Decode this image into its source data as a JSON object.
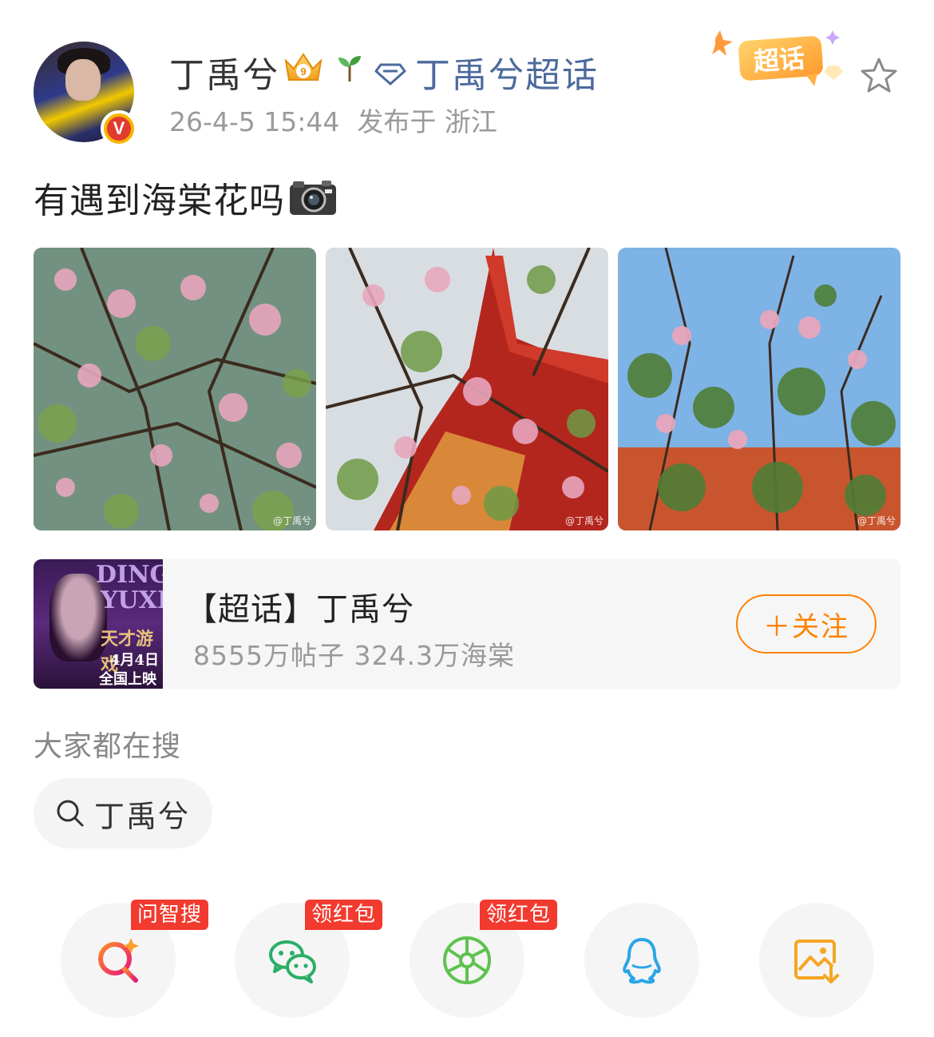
{
  "header": {
    "username": "丁禹兮",
    "supertopic_link": "丁禹兮超话",
    "timestamp": "26-4-5 15:44",
    "location": "发布于 浙江",
    "supertopic_badge": "超话",
    "icons": [
      "avatar",
      "verified-v-icon",
      "crown-level-icon",
      "sprout-icon",
      "diamond-icon",
      "supertopic-badge-icon",
      "star-icon"
    ],
    "level": "9"
  },
  "post": {
    "text": "有遇到海棠花吗",
    "emoji": "camera-icon",
    "images": [
      {
        "name": "photo-1",
        "watermark": "@丁禹兮"
      },
      {
        "name": "photo-2",
        "watermark": "@丁禹兮"
      },
      {
        "name": "photo-3",
        "watermark": "@丁禹兮"
      }
    ]
  },
  "topic_card": {
    "title": "【超话】丁禹兮",
    "stats": "8555万帖子 324.3万海棠",
    "follow_label": "＋关注",
    "poster": {
      "line1": "DING",
      "line2": "YUXI",
      "line3": "天才游戏",
      "line4": "4月4日",
      "line5": "全国上映"
    }
  },
  "search": {
    "heading": "大家都在搜",
    "chip": "丁禹兮"
  },
  "share": {
    "items": [
      {
        "name": "wenzhisou",
        "icon": "search-sparkle-icon",
        "tag": "问智搜",
        "accent": "#f0325a"
      },
      {
        "name": "wechat",
        "icon": "wechat-icon",
        "tag": "领红包",
        "accent": "#2aae67"
      },
      {
        "name": "moments",
        "icon": "moments-shutter-icon",
        "tag": "领红包",
        "accent": "#5ec24f"
      },
      {
        "name": "qq",
        "icon": "qq-icon",
        "tag": "",
        "accent": "#2aa5e8"
      },
      {
        "name": "save-image",
        "icon": "save-image-icon",
        "tag": "",
        "accent": "#f5a623"
      }
    ]
  },
  "colors": {
    "link": "#4c6a9c",
    "follow": "#ff8200",
    "tag_bg": "#f23a2e",
    "meta": "#9a9a9a"
  }
}
